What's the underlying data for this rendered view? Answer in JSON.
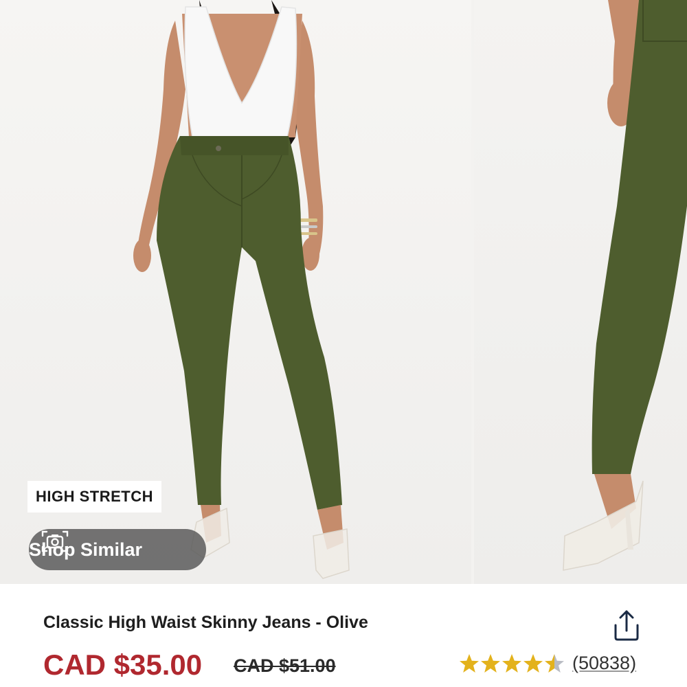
{
  "product": {
    "title": "Classic High Waist Skinny Jeans - Olive",
    "price": "CAD $35.00",
    "original_price": "CAD $51.00",
    "rating": 4.5,
    "review_count": "(50838)"
  },
  "gallery": {
    "badge": "HIGH STRETCH",
    "shop_similar_label": "Shop Similar",
    "images": [
      "model-front-photo",
      "model-side-photo"
    ]
  },
  "icons": {
    "camera": "camera-icon",
    "share": "share-icon",
    "star": "star-icon"
  },
  "colors": {
    "price": "#b0282f",
    "star": "#e3b21c",
    "olive": "#4e5d2e"
  }
}
